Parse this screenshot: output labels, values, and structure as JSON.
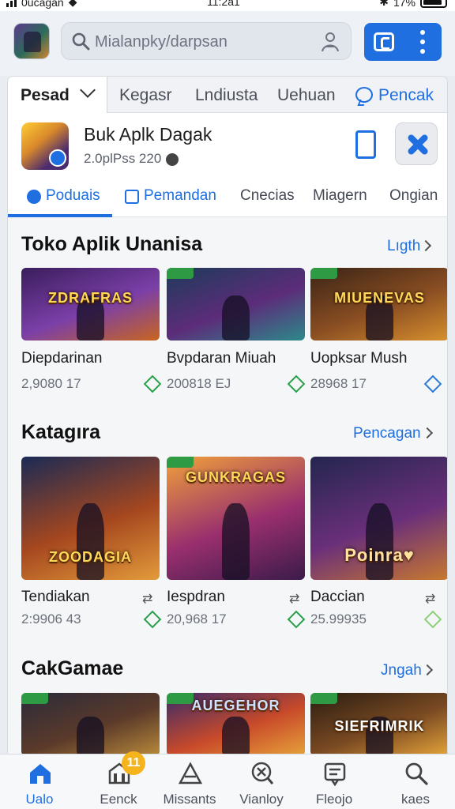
{
  "status_bar": {
    "carrier": "0ucagan",
    "time": "11:2a1",
    "battery": "17%"
  },
  "search": {
    "placeholder": "Mialanpky/darpsan"
  },
  "category_tabs": [
    {
      "label": "Pesad"
    },
    {
      "label": "Kegasr"
    },
    {
      "label": "Lndiusta"
    },
    {
      "label": "Uehuan"
    },
    {
      "label": "Pencak"
    }
  ],
  "app_header": {
    "title": "Buk Aplk Dagak",
    "subtitle": "2.0plPss 220"
  },
  "sub_tabs": [
    {
      "label": "Poduais"
    },
    {
      "label": "Pemandan"
    },
    {
      "label": "Cnecias"
    },
    {
      "label": "Miagern"
    },
    {
      "label": "Ongian"
    }
  ],
  "sections": [
    {
      "title": "Toko Aplik Unanisa",
      "link": "Lıgth",
      "items": [
        {
          "art_text": "ZDRAFRAS",
          "name": "Diepdarinan",
          "meta": "2,9080 17",
          "colors": [
            "#3a1d5c",
            "#7b3fa8",
            "#c8651f"
          ]
        },
        {
          "art_text": "",
          "name": "Bvpdaran Miuah",
          "meta": "200818 EJ",
          "colors": [
            "#1d3b5a",
            "#5c2c7a",
            "#2c8a8a"
          ]
        },
        {
          "art_text": "MIUENEVAS",
          "name": "Uopksar Mush",
          "meta": "28968 17",
          "colors": [
            "#3a2416",
            "#8a4e22",
            "#d8902e"
          ]
        }
      ]
    },
    {
      "title": "Katagıra",
      "link": "Pencagan",
      "items": [
        {
          "art_text": "ZOODAGIA",
          "name": "Tendiakan",
          "meta": "2:9906 43",
          "colors": [
            "#1a2a55",
            "#a5471f",
            "#e39b3a"
          ]
        },
        {
          "art_text": "GUNKRAGAS",
          "name": "Iespdran",
          "meta": "20,968 17",
          "colors": [
            "#f0a13a",
            "#9a2f6e",
            "#3b1b4a"
          ]
        },
        {
          "art_text": "Poinra♥",
          "name": "Daccian",
          "meta": "25.99935",
          "colors": [
            "#23264f",
            "#6a2f7a",
            "#c8792e"
          ]
        }
      ]
    },
    {
      "title": "CakGamae",
      "link": "Jngah",
      "items": [
        {
          "art_text": "",
          "colors": [
            "#2b2b3a",
            "#5b3a2a",
            "#b98a3a"
          ]
        },
        {
          "art_text": "AUEGEHOR",
          "colors": [
            "#3b2a6a",
            "#c84a2a",
            "#e7a23a"
          ]
        },
        {
          "art_text": "SIEFRIMRIK",
          "colors": [
            "#2a1d12",
            "#7a4a22",
            "#e6a43a"
          ]
        }
      ]
    }
  ],
  "bottom_nav": [
    {
      "label": "Ualo",
      "icon": "home-icon"
    },
    {
      "label": "Eenck",
      "icon": "store-icon",
      "badge": "11"
    },
    {
      "label": "Missants",
      "icon": "triangle-icon"
    },
    {
      "label": "Vianloy",
      "icon": "target-icon"
    },
    {
      "label": "Fleojo",
      "icon": "message-icon"
    },
    {
      "label": "kaes",
      "icon": "search-icon"
    }
  ],
  "colors": {
    "accent": "#1f6fe0",
    "green": "#2e9b44"
  }
}
